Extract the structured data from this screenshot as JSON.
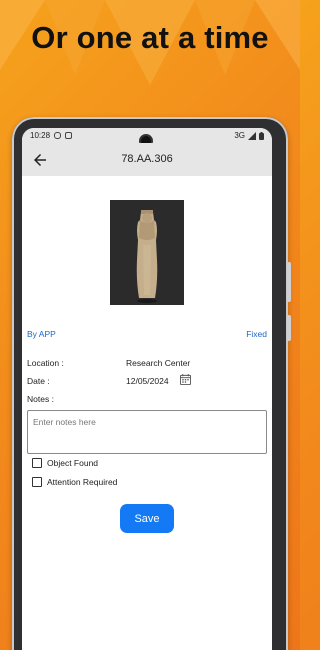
{
  "promo": {
    "headline": "Or one at a time"
  },
  "status_bar": {
    "time": "10:28",
    "network": "3G"
  },
  "app_bar": {
    "title": "78.AA.306"
  },
  "record": {
    "source": "By APP",
    "state": "Fixed",
    "location_label": "Location :",
    "location_value": "Research Center",
    "date_label": "Date :",
    "date_value": "12/05/2024",
    "notes_label": "Notes :",
    "notes_placeholder": "Enter notes here"
  },
  "checks": {
    "object_found": "Object Found",
    "attention_required": "Attention Required"
  },
  "actions": {
    "save_label": "Save"
  },
  "colors": {
    "accent": "#1479f5",
    "background_orange": "#f28a1c"
  },
  "icons": [
    "back-arrow-icon",
    "calendar-icon",
    "wifi-icon",
    "signal-icon",
    "battery-icon"
  ]
}
